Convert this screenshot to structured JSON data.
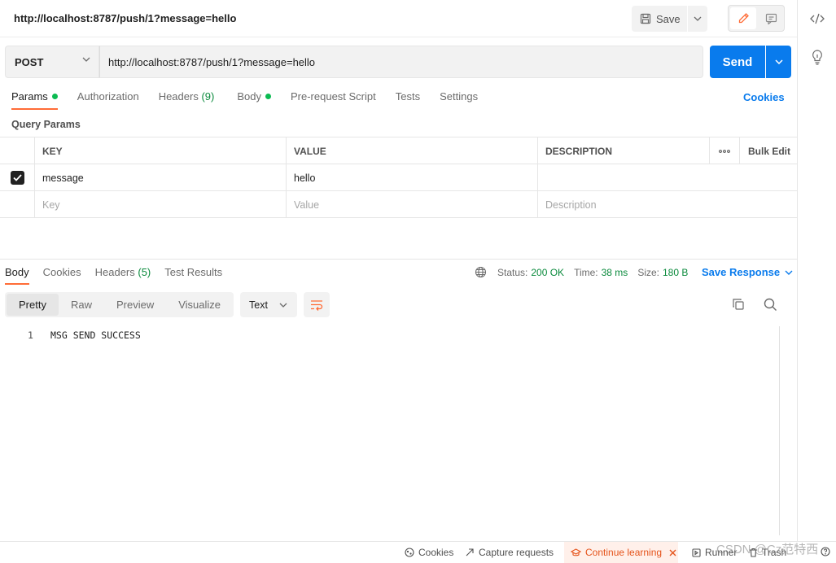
{
  "request": {
    "title": "http://localhost:8787/push/1?message=hello",
    "method": "POST",
    "url": "http://localhost:8787/push/1?message=hello",
    "save_label": "Save",
    "send_label": "Send"
  },
  "request_tabs": {
    "params": "Params",
    "authorization": "Authorization",
    "headers": "Headers",
    "headers_count": "(9)",
    "body": "Body",
    "pre_request": "Pre-request Script",
    "tests": "Tests",
    "settings": "Settings",
    "cookies": "Cookies"
  },
  "query_params": {
    "label": "Query Params",
    "headers": {
      "key": "KEY",
      "value": "VALUE",
      "description": "DESCRIPTION",
      "bulk_edit": "Bulk Edit"
    },
    "rows": [
      {
        "checked": true,
        "key": "message",
        "value": "hello",
        "description": ""
      }
    ],
    "placeholders": {
      "key": "Key",
      "value": "Value",
      "description": "Description"
    }
  },
  "response": {
    "tabs": {
      "body": "Body",
      "cookies": "Cookies",
      "headers": "Headers",
      "headers_count": "(5)",
      "test_results": "Test Results"
    },
    "status_label": "Status:",
    "status_value": "200 OK",
    "time_label": "Time:",
    "time_value": "38 ms",
    "size_label": "Size:",
    "size_value": "180 B",
    "save_response": "Save Response",
    "views": {
      "pretty": "Pretty",
      "raw": "Raw",
      "preview": "Preview",
      "visualize": "Visualize"
    },
    "format": "Text",
    "lines": [
      {
        "no": "1",
        "text": "MSG SEND SUCCESS"
      }
    ]
  },
  "statusbar": {
    "cookies": "Cookies",
    "capture": "Capture requests",
    "learning": "Continue learning",
    "runner": "Runner",
    "trash": "Trash"
  },
  "watermark": "CSDN @Cz范特西",
  "colors": {
    "accent": "#ff6c37",
    "primary": "#097bed",
    "success": "#0cbb52"
  }
}
